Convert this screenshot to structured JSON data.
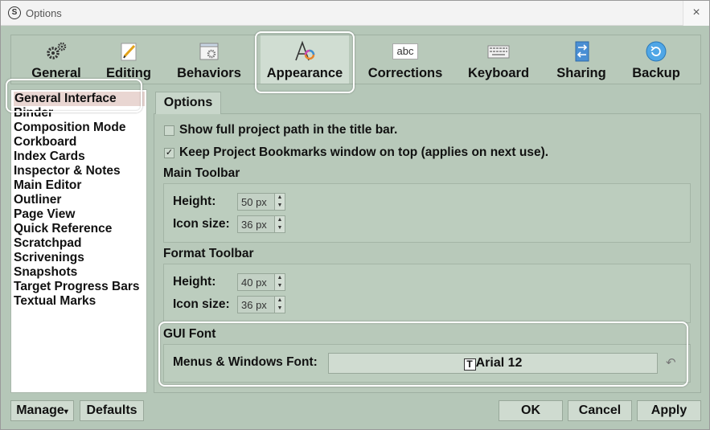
{
  "window": {
    "title": "Options",
    "close_label": "×",
    "app_icon_letter": "S"
  },
  "toolbar": {
    "tabs": [
      {
        "label": "General",
        "icon": "gears-icon"
      },
      {
        "label": "Editing",
        "icon": "pencil-paper-icon"
      },
      {
        "label": "Behaviors",
        "icon": "gear-document-icon"
      },
      {
        "label": "Appearance",
        "icon": "a-color-wheel-icon",
        "active": true
      },
      {
        "label": "Corrections",
        "icon": "abc-icon",
        "icon_text": "abc"
      },
      {
        "label": "Keyboard",
        "icon": "keyboard-icon"
      },
      {
        "label": "Sharing",
        "icon": "sync-document-icon"
      },
      {
        "label": "Backup",
        "icon": "backup-circle-icon"
      }
    ]
  },
  "sidebar": {
    "items": [
      "General Interface",
      "Binder",
      "Composition Mode",
      "Corkboard",
      "Index Cards",
      "Inspector & Notes",
      "Main Editor",
      "Outliner",
      "Page View",
      "Quick Reference",
      "Scratchpad",
      "Scrivenings",
      "Snapshots",
      "Target Progress Bars",
      "Textual Marks"
    ],
    "selected": "General Interface"
  },
  "tab": {
    "label": "Options"
  },
  "options": {
    "show_path_label": "Show full project path in the title bar.",
    "show_path_checked": false,
    "bookmarks_label": "Keep Project Bookmarks window on top (applies on next use).",
    "bookmarks_checked": true,
    "check_mark": "✓"
  },
  "main_toolbar": {
    "title": "Main Toolbar",
    "height_label": "Height:",
    "height_value": "50 px",
    "icon_size_label": "Icon size:",
    "icon_size_value": "36 px"
  },
  "format_toolbar": {
    "title": "Format Toolbar",
    "height_label": "Height:",
    "height_value": "40 px",
    "icon_size_label": "Icon size:",
    "icon_size_value": "36 px"
  },
  "gui_font": {
    "title": "GUI Font",
    "menus_label": "Menus & Windows Font:",
    "font_value": "Arial 12",
    "font_icon": "T",
    "reset_glyph": "↶"
  },
  "spinner_arrows": {
    "up": "▲",
    "down": "▼"
  },
  "bottom": {
    "manage": "Manage",
    "manage_arrow": "▾",
    "defaults": "Defaults",
    "ok": "OK",
    "cancel": "Cancel",
    "apply": "Apply"
  },
  "colors": {
    "window_bg": "#b5c7b8",
    "list_bg": "#ffffff",
    "selection": "#e9d6d2",
    "highlight_box": "#ffffff"
  }
}
